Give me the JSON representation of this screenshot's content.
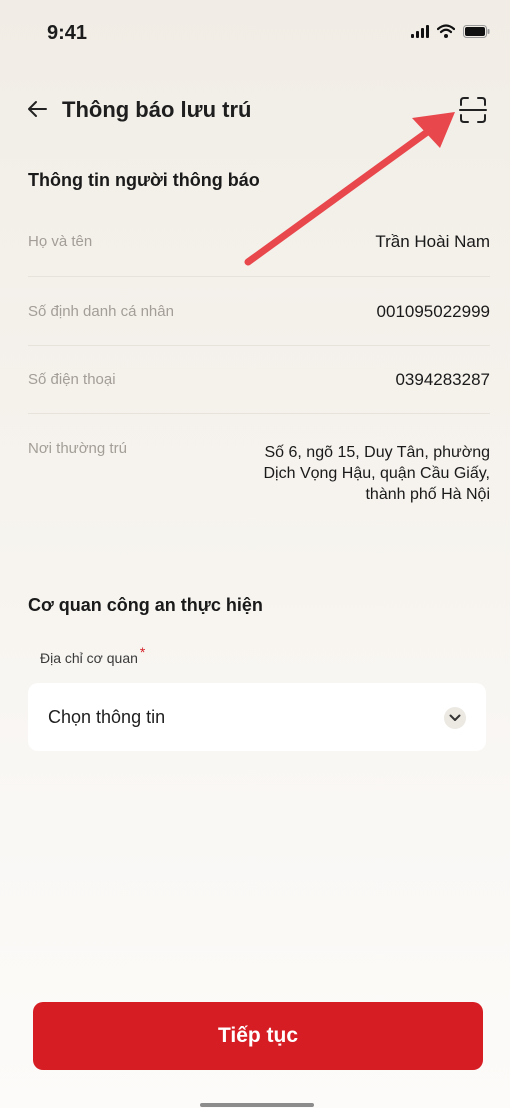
{
  "status_bar": {
    "time": "9:41",
    "icons": [
      "signal-icon",
      "wifi-icon",
      "battery-icon"
    ]
  },
  "header": {
    "title": "Thông báo lưu trú",
    "back_icon": "arrow-left-icon",
    "action_icon": "scan-icon"
  },
  "notifier_section": {
    "title": "Thông tin người thông báo",
    "rows": [
      {
        "label": "Họ và tên",
        "value": "Trần Hoài Nam"
      },
      {
        "label": "Số định danh cá nhân",
        "value": "001095022999"
      },
      {
        "label": "Số điện thoại",
        "value": "0394283287"
      },
      {
        "label": "Nơi thường trú",
        "value": "Số 6, ngõ 15, Duy Tân, phường Dịch Vọng Hậu, quận Cầu Giấy, thành phố Hà Nội"
      }
    ]
  },
  "police_section": {
    "title": "Cơ quan công an thực hiện",
    "field_label": "Địa chỉ cơ quan",
    "required_mark": "*",
    "select_value": "Chọn thông tin"
  },
  "footer": {
    "continue_label": "Tiếp tục"
  },
  "colors": {
    "accent": "#d71d24",
    "annotation_arrow": "#e8474c",
    "background": "#f3efe9"
  }
}
